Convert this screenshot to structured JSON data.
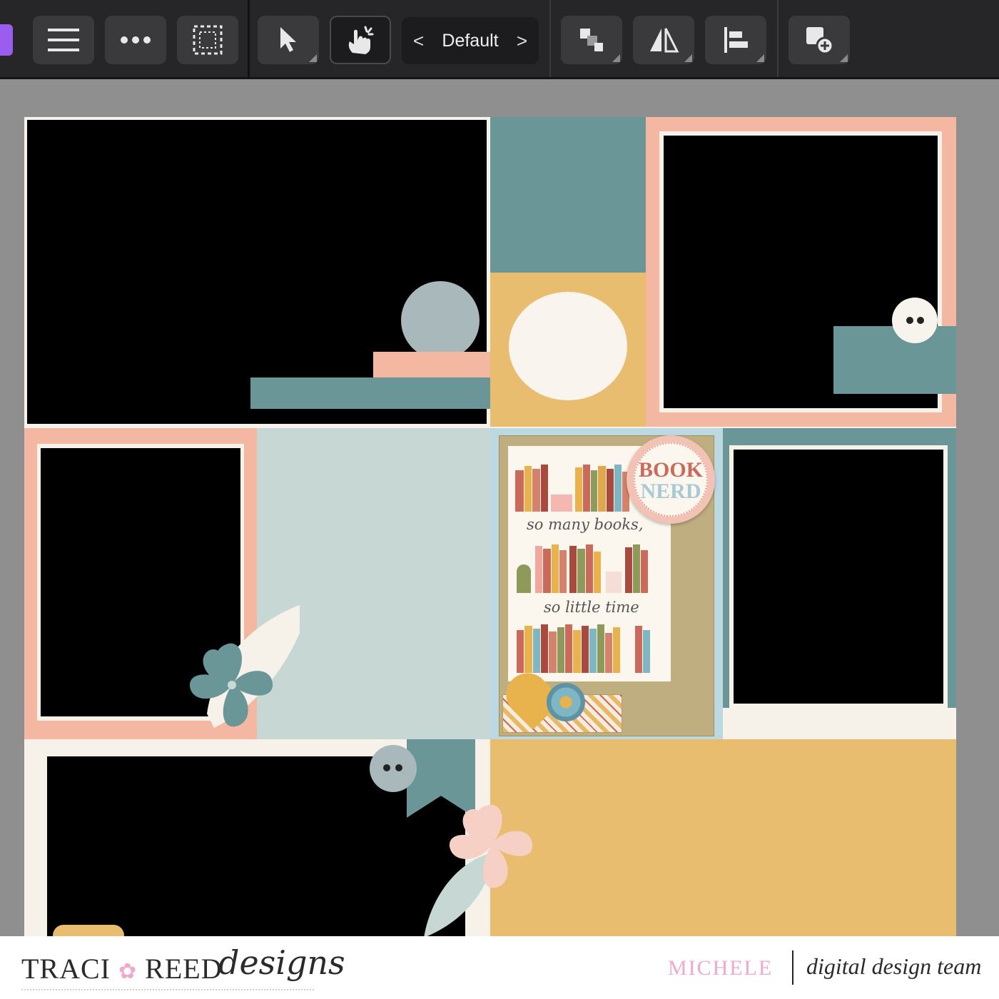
{
  "toolbar": {
    "preset_label": "Default",
    "prev_glyph": "<",
    "next_glyph": ">",
    "buttons": [
      {
        "name": "studio-icon"
      },
      {
        "name": "hamburger-menu-icon"
      },
      {
        "name": "more-options-icon"
      },
      {
        "name": "marquee-select-icon"
      },
      {
        "name": "move-tool-icon"
      },
      {
        "name": "touch-gesture-icon"
      },
      {
        "name": "arrange-icon"
      },
      {
        "name": "flip-icon"
      },
      {
        "name": "align-icon"
      },
      {
        "name": "insert-add-icon"
      }
    ]
  },
  "canvas": {
    "book_card": {
      "line1": "so many books,",
      "line2": "so little time",
      "badge_top": "BOOK",
      "badge_bottom": "NERD"
    }
  },
  "footer": {
    "brand": "TRACI",
    "brand_mid": "REED",
    "brand_script": "designs",
    "designer": "MICHELE",
    "team": "digital design team"
  },
  "colors": {
    "teal": "#6a9697",
    "peach": "#f4b8a2",
    "mint": "#c7d8d4",
    "mustard": "#e8bd70",
    "cream": "#f6f2ea",
    "accent_purple": "#9b5cf0",
    "designer_pink": "#f0a8cc"
  }
}
